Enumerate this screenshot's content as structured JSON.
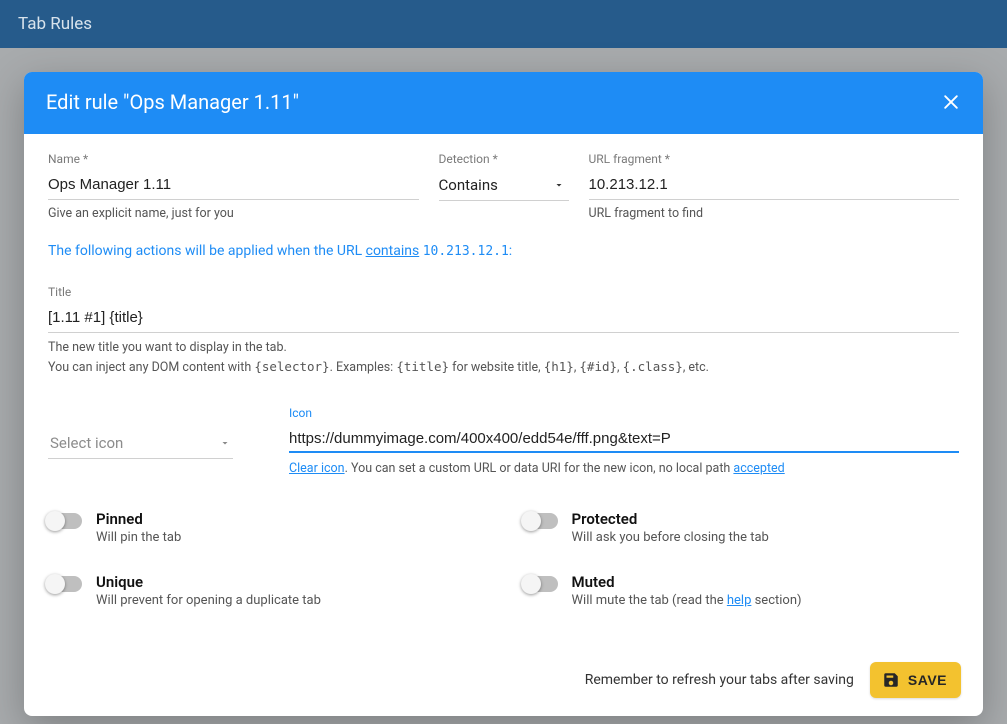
{
  "header": {
    "title": "Tab Rules"
  },
  "dialog": {
    "title": "Edit rule \"Ops Manager 1.11\"",
    "name": {
      "label": "Name *",
      "value": "Ops Manager 1.11",
      "hint": "Give an explicit name, just for you"
    },
    "detection": {
      "label": "Detection *",
      "value": "Contains"
    },
    "url": {
      "label": "URL fragment *",
      "value": "10.213.12.1",
      "hint": "URL fragment to find"
    },
    "intro": {
      "prefix": "The following actions will be applied when the URL ",
      "verb": "contains",
      "target": "10.213.12.1",
      "suffix": ":"
    },
    "title_field": {
      "label": "Title",
      "value": "[1.11 #1] {title}",
      "hint1": "The new title you want to display in the tab.",
      "hint2a": "You can inject any DOM content with ",
      "hint2b": "{selector}",
      "hint2c": ". Examples: ",
      "hint2d": "{title}",
      "hint2e": " for website title, ",
      "hint2f": "{h1}",
      "hint2g": ", ",
      "hint2h": "{#id}",
      "hint2i": ", ",
      "hint2j": "{.class}",
      "hint2k": ", etc."
    },
    "icon": {
      "select_placeholder": "Select icon",
      "label": "Icon",
      "url_value": "https://dummyimage.com/400x400/edd54e/fff.png&text=P",
      "clear": "Clear icon",
      "hint_mid": ". You can set a custom URL or data URI for the new icon, no local path ",
      "hint_link": "accepted"
    },
    "toggles": {
      "pinned": {
        "title": "Pinned",
        "sub": "Will pin the tab"
      },
      "protected": {
        "title": "Protected",
        "sub": "Will ask you before closing the tab"
      },
      "unique": {
        "title": "Unique",
        "sub": "Will prevent for opening a duplicate tab"
      },
      "muted": {
        "title": "Muted",
        "sub_a": "Will mute the tab (read the ",
        "help": "help",
        "sub_b": " section)"
      }
    },
    "footer": {
      "note": "Remember to refresh your tabs after saving",
      "save": "SAVE"
    }
  }
}
